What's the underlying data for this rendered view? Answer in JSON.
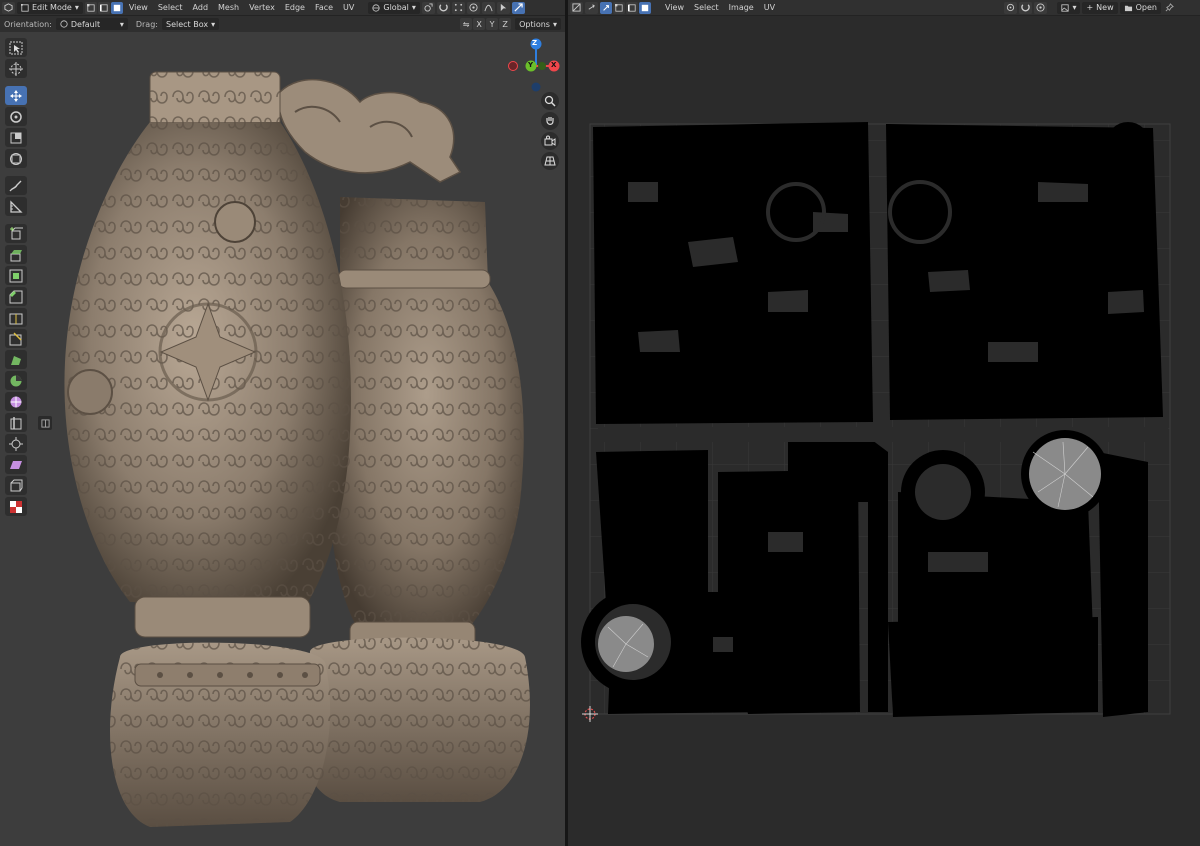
{
  "viewport": {
    "header": {
      "editor_icon": "3d-viewport-icon",
      "mode": "Edit Mode",
      "menus": [
        "View",
        "Select",
        "Add",
        "Mesh",
        "Vertex",
        "Edge",
        "Face",
        "UV"
      ],
      "transform_orientation": "Global"
    },
    "tool_header": {
      "orientation_label": "Orientation:",
      "orientation_value": "Default",
      "drag_label": "Drag:",
      "drag_value": "Select Box",
      "axis_x": "X",
      "axis_y": "Y",
      "axis_z": "Z",
      "options": "Options"
    },
    "gizmo": {
      "z": "Z",
      "y": "Y",
      "x": "X",
      "colors": {
        "x": "#f0464b",
        "y": "#6bbf2a",
        "z": "#2f7fe0"
      }
    },
    "accent_color": "#4772b3"
  },
  "uv_editor": {
    "header": {
      "editor_icon": "uv-editor-icon",
      "menus": [
        "View",
        "Select",
        "Image",
        "UV"
      ],
      "new_label": "New",
      "open_label": "Open"
    }
  }
}
